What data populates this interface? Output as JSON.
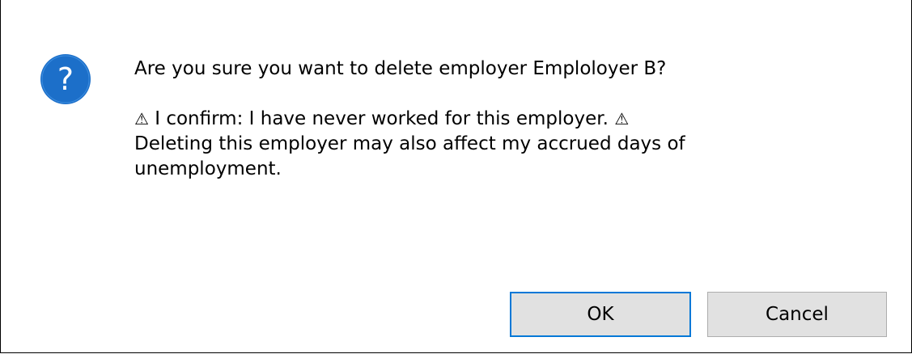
{
  "dialog": {
    "icon": "question-icon",
    "icon_color": "#1c6fc9",
    "question": "Are you sure you want to delete employer Emploloyer B?",
    "warning_glyph": "⚠",
    "warning_line1_text": " I confirm: I have never worked for this employer. ",
    "warning_line2": "Deleting this employer may also affect my accrued days of",
    "warning_line3": "unemployment."
  },
  "buttons": {
    "ok_label": "OK",
    "cancel_label": "Cancel"
  }
}
